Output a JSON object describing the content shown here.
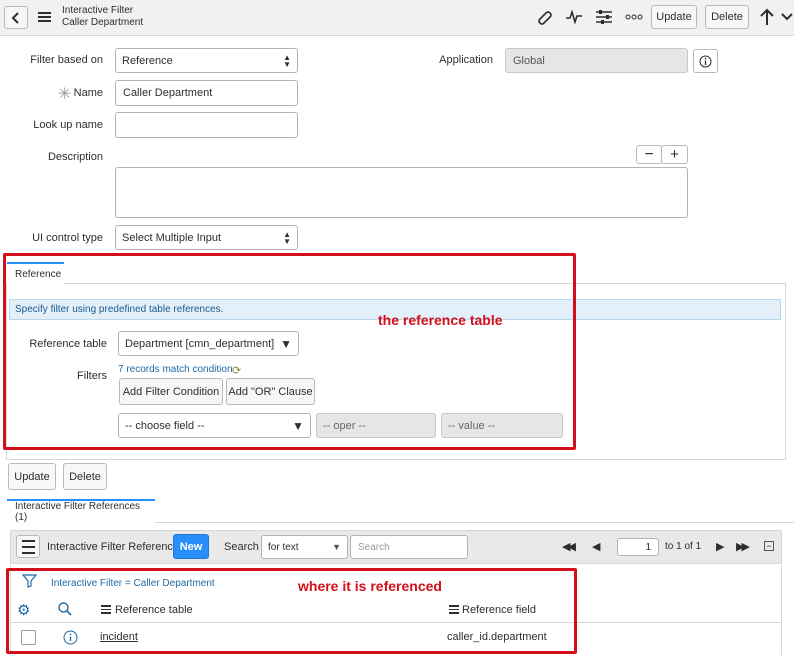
{
  "header": {
    "title": "Interactive Filter",
    "subtitle": "Caller Department",
    "update_label": "Update",
    "delete_label": "Delete"
  },
  "form": {
    "filter_based_on": {
      "label": "Filter based on",
      "value": "Reference"
    },
    "application": {
      "label": "Application",
      "value": "Global"
    },
    "name": {
      "label": "Name",
      "value": "Caller Department"
    },
    "lookup_name": {
      "label": "Look up name",
      "value": ""
    },
    "description": {
      "label": "Description",
      "value": ""
    },
    "ui_control_type": {
      "label": "UI control type",
      "value": "Select Multiple Input"
    }
  },
  "reference_section": {
    "tab_label": "Reference",
    "info_text": "Specify filter using predefined table references.",
    "annotation": "the reference table",
    "reference_table": {
      "label": "Reference table",
      "value": "Department [cmn_department]"
    },
    "filters": {
      "label": "Filters",
      "match_text": "7 records match condition",
      "add_condition_label": "Add Filter Condition",
      "add_or_label": "Add \"OR\" Clause",
      "field_placeholder": "-- choose field --",
      "oper_placeholder": "-- oper --",
      "value_placeholder": "-- value --"
    }
  },
  "actions": {
    "update_label": "Update",
    "delete_label": "Delete"
  },
  "related_list": {
    "tab_label": "Interactive Filter References (1)",
    "title": "Interactive Filter References",
    "new_label": "New",
    "search_label": "Search",
    "search_field_value": "for text",
    "search_placeholder": "Search",
    "page_value": "1",
    "page_info": "to 1 of 1",
    "breadcrumb": "Interactive Filter = Caller Department",
    "annotation": "where it is referenced",
    "columns": [
      "Reference table",
      "Reference field"
    ],
    "rows": [
      {
        "reference_table": "incident",
        "reference_field": "caller_id.department"
      }
    ]
  }
}
